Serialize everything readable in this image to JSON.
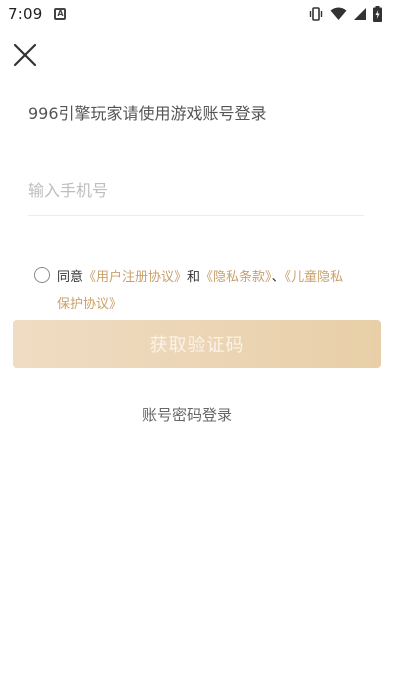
{
  "status_bar": {
    "time": "7:09",
    "app_indicator": "A"
  },
  "header": {
    "title": "996引擎玩家请使用游戏账号登录"
  },
  "form": {
    "phone_placeholder": "输入手机号"
  },
  "agreement": {
    "prefix": "同意",
    "user_agreement": "《用户注册协议》",
    "and": "和",
    "privacy_terms": "《隐私条款》",
    "separator": "、",
    "child_privacy_line1": "《儿童隐私",
    "child_privacy_line2": "保护协议》"
  },
  "actions": {
    "get_code_label": "获取验证码",
    "password_login_label": "账号密码登录"
  },
  "colors": {
    "accent_link": "#c9a06a",
    "button_bg": "#ecd6b6"
  }
}
